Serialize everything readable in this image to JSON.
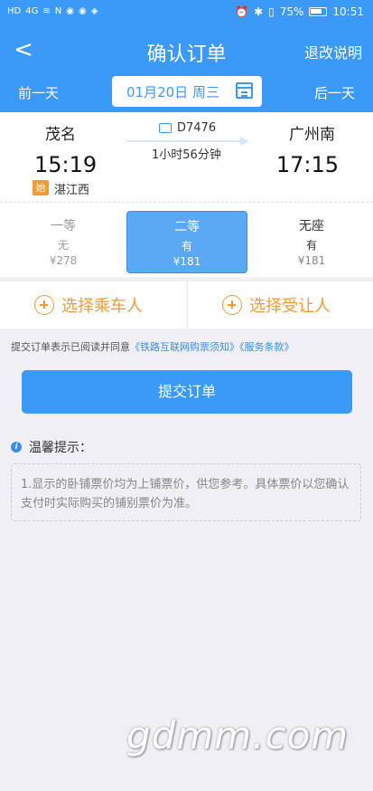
{
  "status_bar": {
    "left_icons": [
      "HD",
      "4G",
      "wifi",
      "N",
      "app",
      "app",
      "app"
    ],
    "battery": "75%",
    "time": "10:51"
  },
  "header": {
    "title": "确认订单",
    "back": "<",
    "refund_link": "退改说明"
  },
  "date_bar": {
    "prev_day": "前一天",
    "date": "01月20日 周三",
    "next_day": "后一天"
  },
  "trip": {
    "from_station": "茂名",
    "depart_time": "15:19",
    "to_station": "广州南",
    "arrive_time": "17:15",
    "start_badge": "始",
    "start_station": "湛江西",
    "train_no": "D7476",
    "duration": "1小时56分钟"
  },
  "seats": [
    {
      "name": "一等",
      "availability": "无",
      "price": "¥278"
    },
    {
      "name": "二等",
      "availability": "有",
      "price": "¥181",
      "selected": true
    },
    {
      "name": "无座",
      "availability": "有",
      "price": "¥181"
    }
  ],
  "actions": {
    "select_passenger": "选择乘车人",
    "select_transferee": "选择受让人"
  },
  "agreement": {
    "prefix": "提交订单表示已阅读并同意",
    "notice_link": "《铁路互联网购票须知》",
    "terms_link": "《服务条款》"
  },
  "submit_label": "提交订单",
  "tips": {
    "title": "温馨提示：",
    "text": "1.显示的卧铺票价均为上铺票价，供您参考。具体票价以您确认支付时实际购买的铺别票价为准。"
  },
  "watermark": "gdmm.com",
  "colors": {
    "primary": "#3b99f7",
    "accent": "#f39a32"
  }
}
